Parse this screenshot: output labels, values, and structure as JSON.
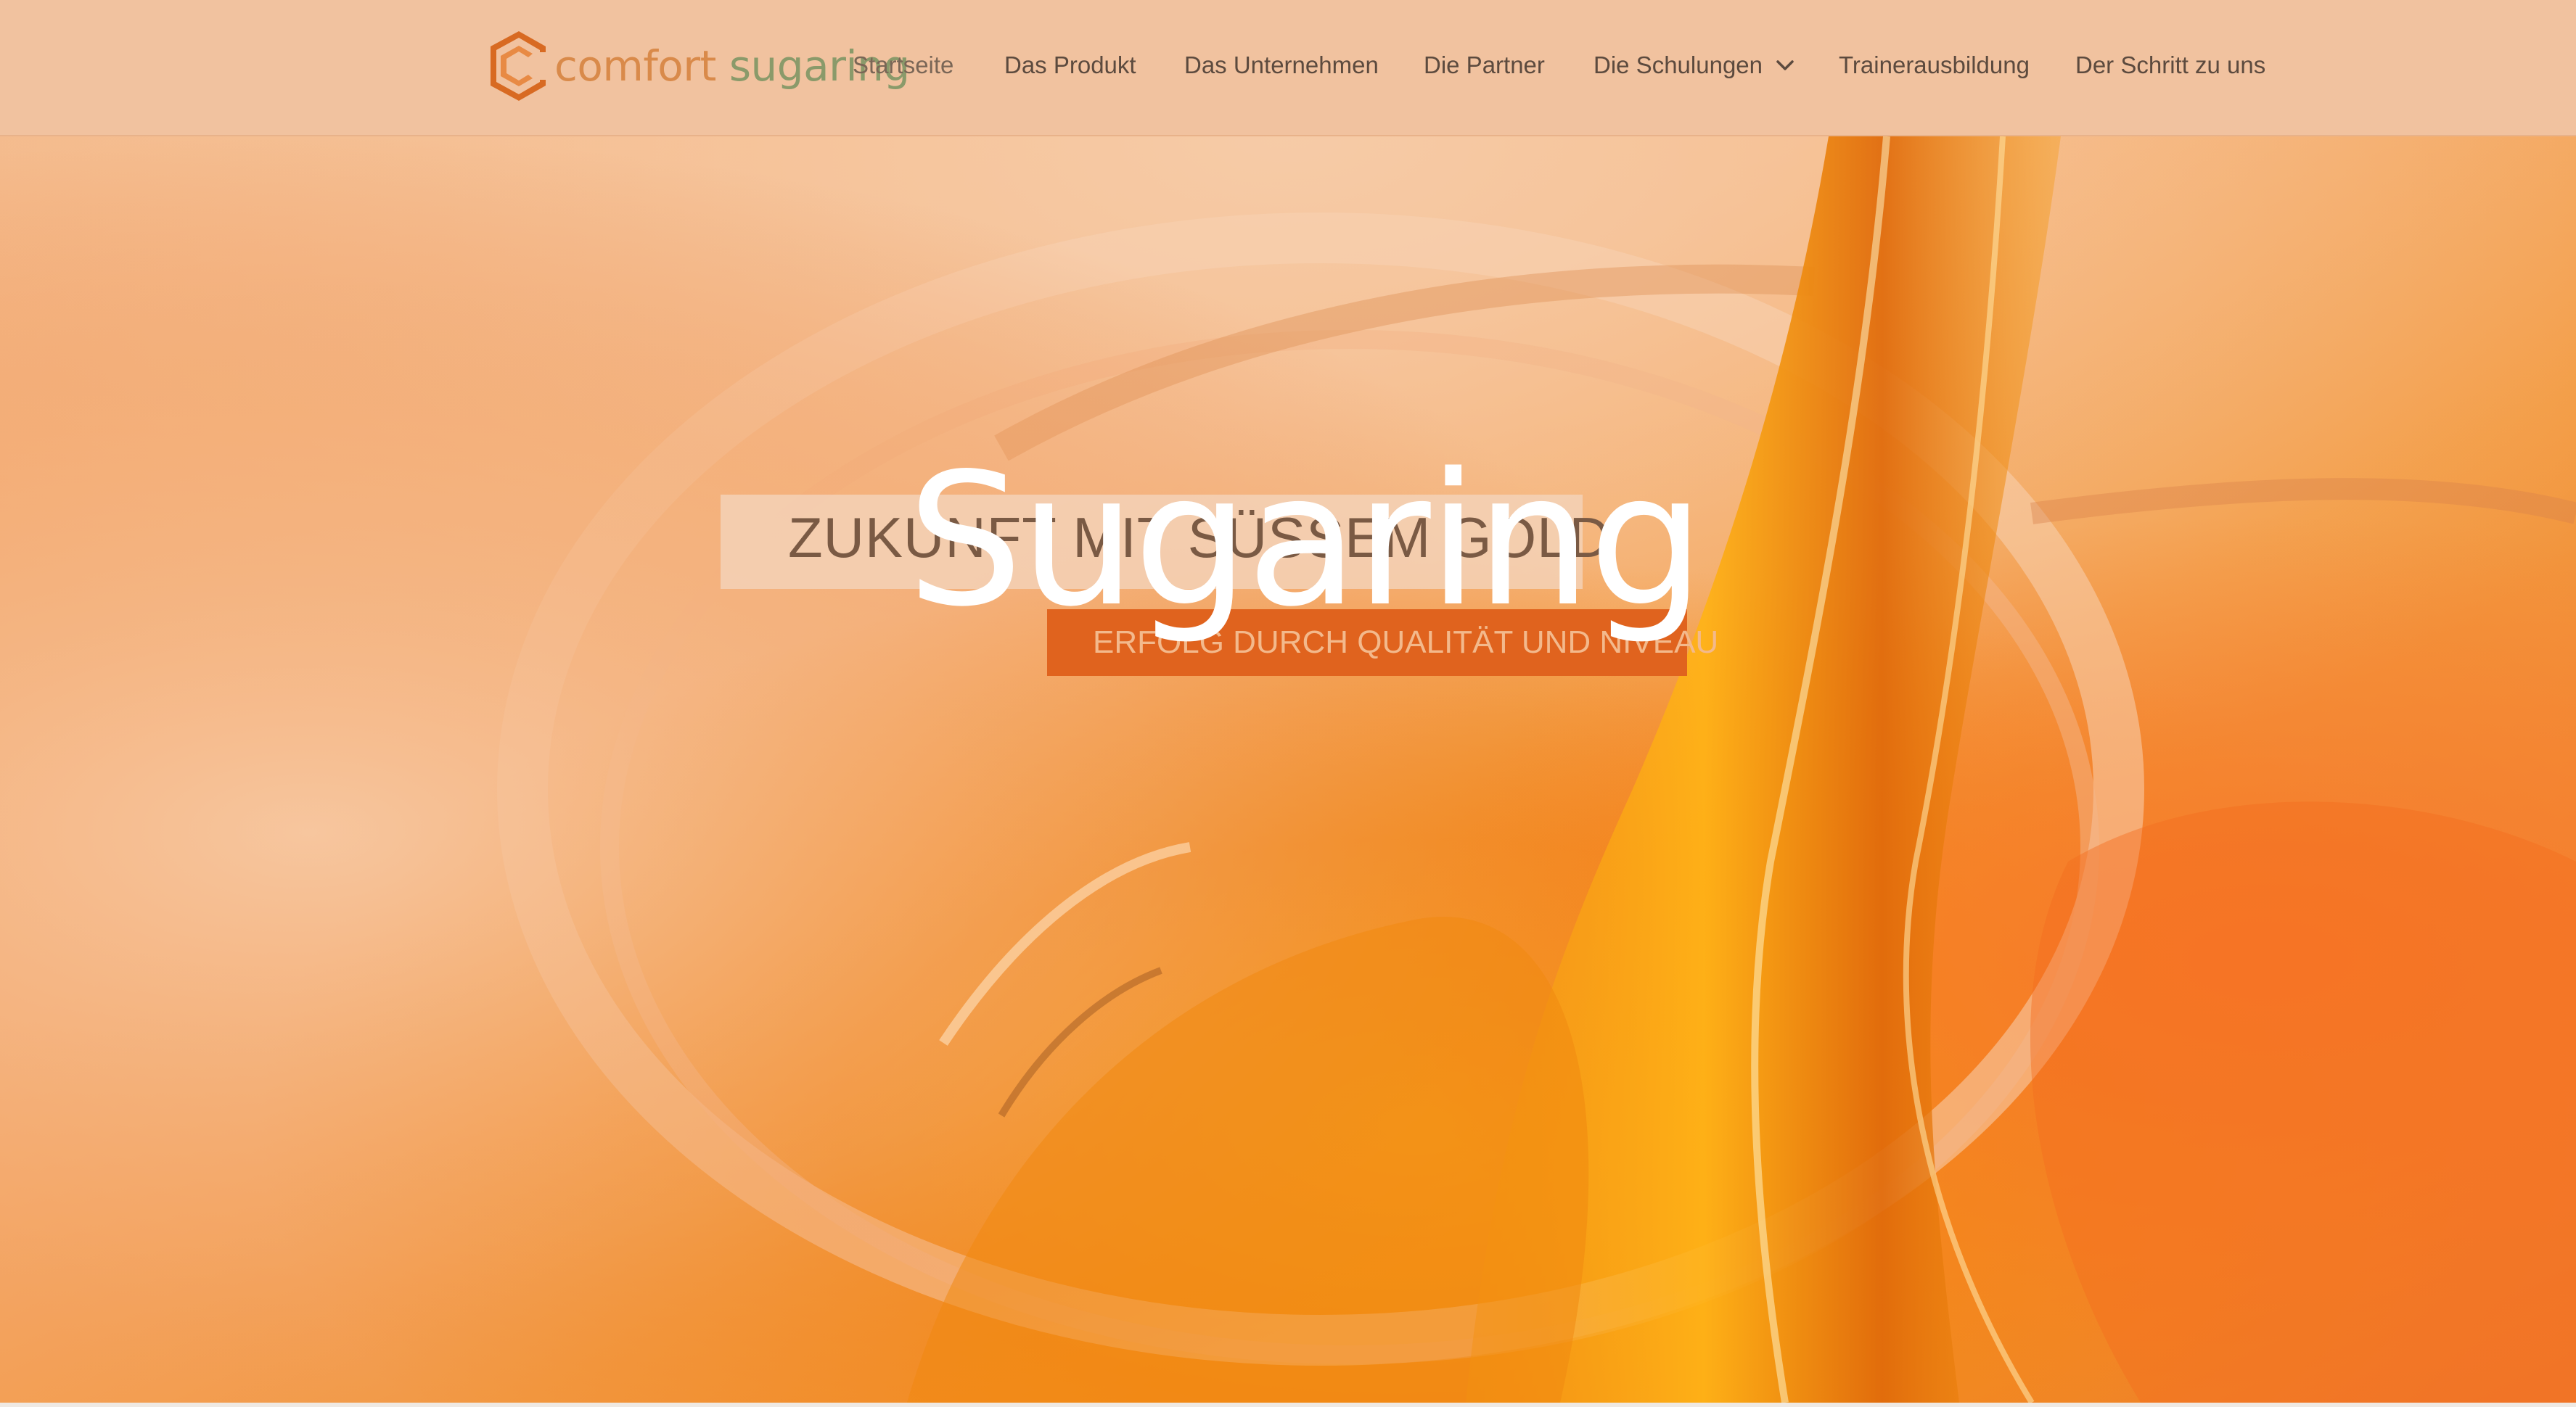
{
  "header": {
    "logo": {
      "word1": "comfort",
      "word2": "sugaring",
      "icon": "hexagon-c-logo-icon"
    },
    "nav": [
      {
        "label": "Startseite",
        "active": true
      },
      {
        "label": "Das Produkt"
      },
      {
        "label": "Das Unternehmen"
      },
      {
        "label": "Die Partner"
      },
      {
        "label": "Die Schulungen",
        "icon": "chevron-down-icon"
      },
      {
        "label": "Trainerausbildung"
      },
      {
        "label": "Der Schritt zu uns"
      }
    ]
  },
  "hero": {
    "title": "Sugaring",
    "tagline": "ZUKUNFT MIT SÜSSEM GOLD",
    "subline": "ERFOLG DURCH QUALITÄT UND NIVEAU"
  },
  "colors": {
    "header_bg": "#f1c29f",
    "accent_orange": "#e0631e",
    "logo_orange": "#d98a4a",
    "logo_green": "#8a9a6a",
    "nav_text": "#5c4a3e",
    "title": "#ffffff"
  }
}
